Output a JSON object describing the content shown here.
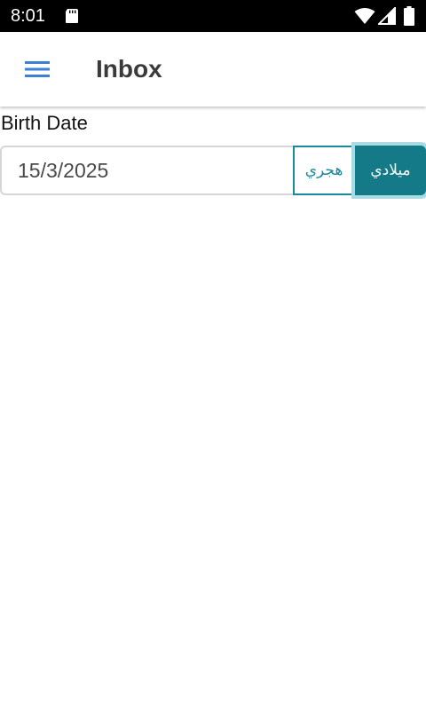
{
  "status_bar": {
    "time": "8:01",
    "icons": [
      "sd-card-icon",
      "wifi-icon",
      "signal-icon",
      "battery-icon"
    ]
  },
  "app_bar": {
    "menu_icon": "hamburger-menu-icon",
    "title": "Inbox",
    "accent_color": "#3b82d6"
  },
  "form": {
    "birth_date": {
      "label": "Birth Date",
      "value": "15/3/2025",
      "calendar_options": {
        "hijri_label": "هجري",
        "gregorian_label": "ميلادي",
        "selected": "gregorian"
      }
    }
  },
  "colors": {
    "primary": "#157a88",
    "primary_outline": "#1a8a9a",
    "focus_ring": "#a8dbe3",
    "status_bar_bg": "#000000"
  }
}
